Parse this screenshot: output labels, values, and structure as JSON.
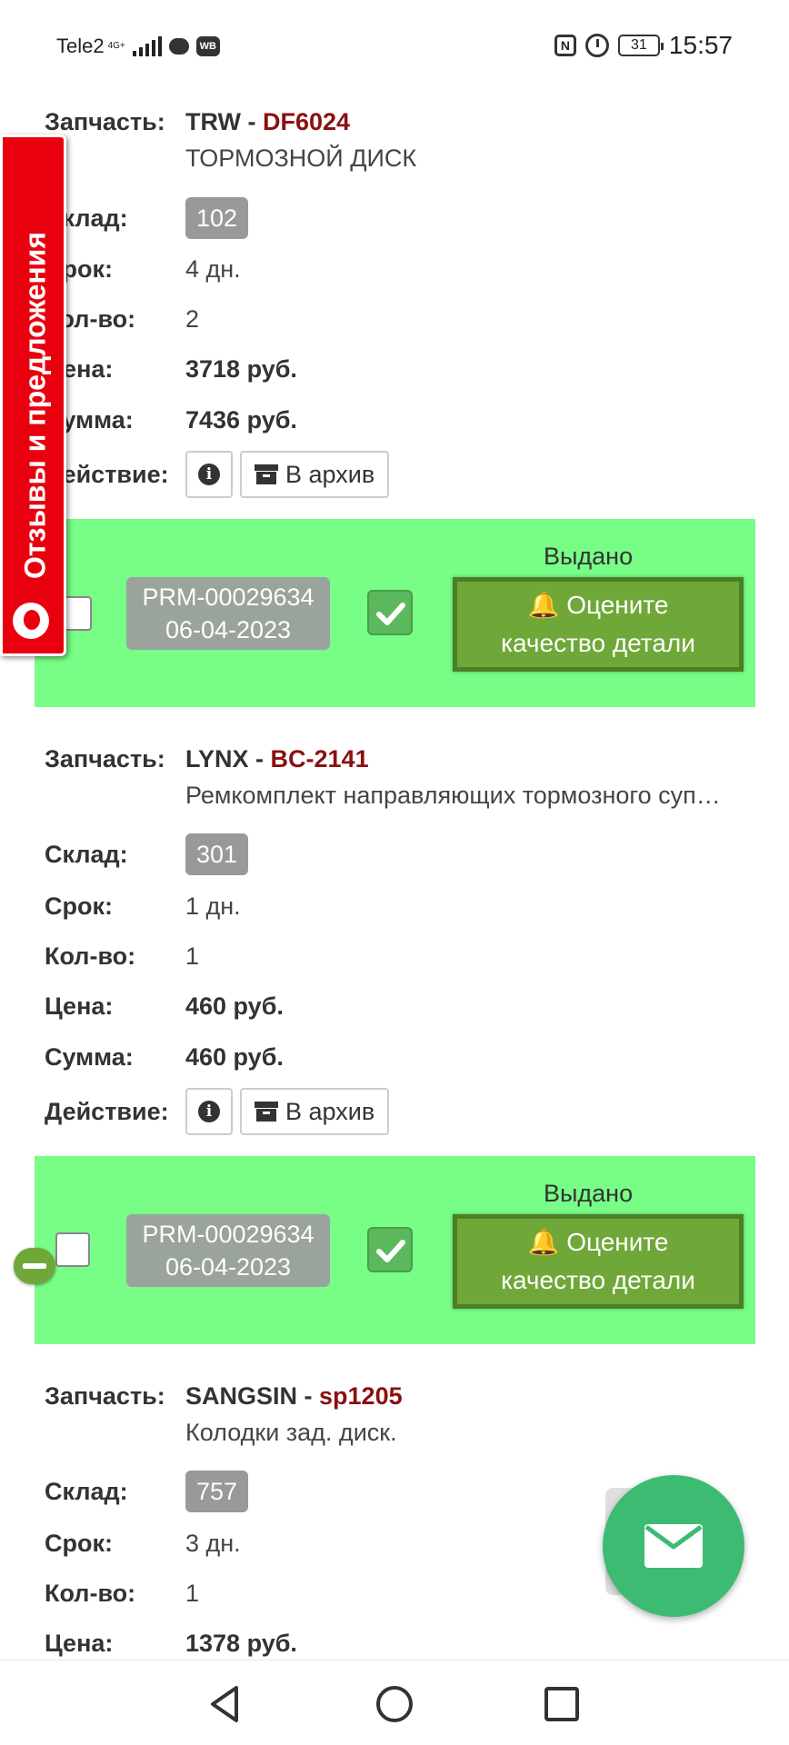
{
  "status_bar": {
    "carrier": "Tele2",
    "network": "4G+",
    "wb_icon": "WB",
    "nfc_icon": "N",
    "battery": "31",
    "time": "15:57"
  },
  "side_tab": {
    "label": "Отзывы и предложения"
  },
  "labels": {
    "part": "Запчасть:",
    "warehouse": "Склад:",
    "term": "Срок:",
    "qty": "Кол-во:",
    "price": "Цена:",
    "sum": "Сумма:",
    "action": "Действие:"
  },
  "actions": {
    "archive": "В архив",
    "info_glyph": "i"
  },
  "panel": {
    "issued": "Выдано",
    "rate_line1": "🔔 Оцените",
    "rate_line2": "качество детали"
  },
  "items": [
    {
      "brand": "TRW",
      "sep": " - ",
      "article": "DF6024",
      "description": "ТОРМОЗНОЙ ДИСК",
      "warehouse": "102",
      "term": "4 дн.",
      "qty": "2",
      "price": "3718 руб.",
      "sum": "7436 руб.",
      "order": "PRM-00029634",
      "date": "06-04-2023"
    },
    {
      "brand": "LYNX",
      "sep": " - ",
      "article": "BC-2141",
      "description": "Ремкомплект направляющих тормозного суппорта",
      "warehouse": "301",
      "term": "1 дн.",
      "qty": "1",
      "price": "460 руб.",
      "sum": "460 руб.",
      "order": "PRM-00029634",
      "date": "06-04-2023"
    },
    {
      "brand": "SANGSIN",
      "sep": " - ",
      "article": "sp1205",
      "description": "Колодки зад. диск.",
      "warehouse": "757",
      "term": "3 дн.",
      "qty": "1",
      "price": "1378 руб."
    }
  ],
  "icons": {
    "fab": "envelope-icon",
    "nav": [
      "back-triangle-icon",
      "home-circle-icon",
      "recents-square-icon"
    ]
  },
  "colors": {
    "panel_bg": "#78fd86",
    "rate_btn": "#6fa838",
    "article": "#8b1010",
    "side_tab": "#e8000f",
    "fab": "#3dbb72"
  }
}
